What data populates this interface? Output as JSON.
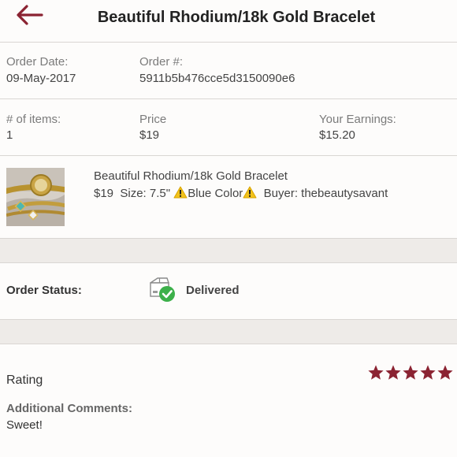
{
  "header": {
    "title": "Beautiful Rhodium/18k Gold Bracelet",
    "back_icon": "back-arrow-icon"
  },
  "order": {
    "date_label": "Order Date:",
    "date_value": "09-May-2017",
    "number_label": "Order #:",
    "number_value": "5911b5b476cce5d3150090e6"
  },
  "summary": {
    "items_label": "# of items:",
    "items_value": "1",
    "price_label": "Price",
    "price_value": "$19",
    "earnings_label": "Your Earnings:",
    "earnings_value": "$15.20"
  },
  "item": {
    "title": "Beautiful Rhodium/18k Gold Bracelet",
    "price": "$19",
    "size_text": "Size: 7.5\"",
    "color_text": "Blue Color",
    "buyer_text": "Buyer: thebeautysavant",
    "warning_icon": "warning-icon"
  },
  "status": {
    "label": "Order Status:",
    "value": "Delivered",
    "icon": "package-delivered-icon"
  },
  "rating": {
    "label": "Rating",
    "stars": 5,
    "max_stars": 5,
    "star_color": "#8b2332",
    "comments_label": "Additional Comments:",
    "comments_value": "Sweet!"
  },
  "colors": {
    "accent": "#8b2332",
    "check_green": "#3cb04a",
    "divider": "#d9d6d3",
    "section_gap": "#eeebe8"
  }
}
